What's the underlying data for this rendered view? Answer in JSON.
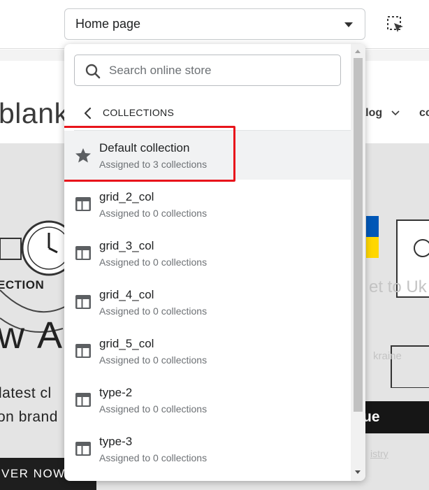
{
  "toolbar": {
    "page_select_value": "Home page",
    "inspect_icon": "select-element-icon"
  },
  "store_preview": {
    "logo": "blank",
    "nav_items": [
      "atalog",
      "co"
    ],
    "hero_label": "ECTION",
    "hero_title": "w A",
    "hero_line1": "latest cl",
    "hero_line2": "on brand",
    "shop_button": "VER NOW",
    "donate_button": "ue",
    "faint_heading": "et to Uk",
    "faint_line": "kraine",
    "faint_link": "istry"
  },
  "dropdown": {
    "search_placeholder": "Search online store",
    "section_title": "COLLECTIONS",
    "items": [
      {
        "name": "Default collection",
        "sub": "Assigned to 3 collections",
        "icon": "star-icon",
        "selected": true
      },
      {
        "name": "grid_2_col",
        "sub": "Assigned to 0 collections",
        "icon": "template-icon"
      },
      {
        "name": "grid_3_col",
        "sub": "Assigned to 0 collections",
        "icon": "template-icon"
      },
      {
        "name": "grid_4_col",
        "sub": "Assigned to 0 collections",
        "icon": "template-icon"
      },
      {
        "name": "grid_5_col",
        "sub": "Assigned to 0 collections",
        "icon": "template-icon"
      },
      {
        "name": "type-2",
        "sub": "Assigned to 0 collections",
        "icon": "template-icon"
      },
      {
        "name": "type-3",
        "sub": "Assigned to 0 collections",
        "icon": "template-icon"
      }
    ]
  },
  "colors": {
    "highlight": "#e8141b",
    "selected_row": "#f1f2f3",
    "icon": "#5c5f62"
  }
}
